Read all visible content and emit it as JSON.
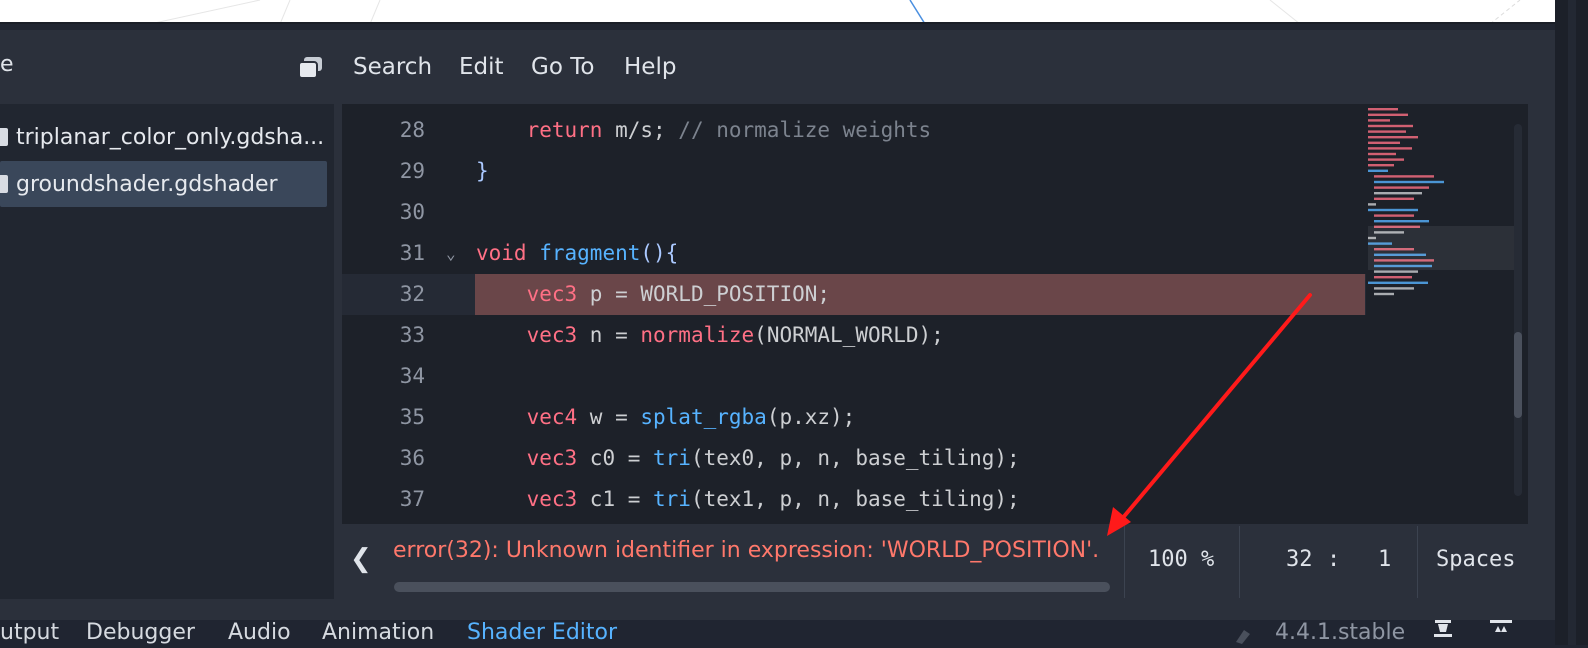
{
  "menu": {
    "left_partial": "e",
    "items": [
      "Search",
      "Edit",
      "Go To",
      "Help"
    ]
  },
  "files": [
    {
      "name": "triplanar_color_only.gdsha...",
      "selected": false
    },
    {
      "name": "groundshader.gdshader",
      "selected": true
    }
  ],
  "code_lines": [
    {
      "num": "28",
      "tokens": [
        [
          "    ",
          "id"
        ],
        [
          "return",
          "kw"
        ],
        [
          " m/s; ",
          "id"
        ],
        [
          "// normalize weights",
          "cm"
        ]
      ]
    },
    {
      "num": "29",
      "tokens": [
        [
          "}",
          "pn"
        ]
      ]
    },
    {
      "num": "30",
      "tokens": []
    },
    {
      "num": "31",
      "fold": true,
      "tokens": [
        [
          "void",
          "kw"
        ],
        [
          " ",
          "id"
        ],
        [
          "fragment",
          "fn"
        ],
        [
          "(){",
          "pn"
        ]
      ]
    },
    {
      "num": "32",
      "error": true,
      "tokens": [
        [
          "    ",
          "id"
        ],
        [
          "vec3",
          "kw"
        ],
        [
          " p = WORLD_POSITION;",
          "id"
        ]
      ]
    },
    {
      "num": "33",
      "tokens": [
        [
          "    ",
          "id"
        ],
        [
          "vec3",
          "kw"
        ],
        [
          " n = ",
          "id"
        ],
        [
          "normalize",
          "kw"
        ],
        [
          "(NORMAL_WORLD);",
          "id"
        ]
      ]
    },
    {
      "num": "34",
      "tokens": []
    },
    {
      "num": "35",
      "tokens": [
        [
          "    ",
          "id"
        ],
        [
          "vec4",
          "kw"
        ],
        [
          " w = ",
          "id"
        ],
        [
          "splat_rgba",
          "fn"
        ],
        [
          "(p.xz);",
          "id"
        ]
      ]
    },
    {
      "num": "36",
      "tokens": [
        [
          "    ",
          "id"
        ],
        [
          "vec3",
          "kw"
        ],
        [
          " c0 = ",
          "id"
        ],
        [
          "tri",
          "fn"
        ],
        [
          "(tex0, p, n, base_tiling);",
          "id"
        ]
      ]
    },
    {
      "num": "37",
      "tokens": [
        [
          "    ",
          "id"
        ],
        [
          "vec3",
          "kw"
        ],
        [
          " c1 = ",
          "id"
        ],
        [
          "tri",
          "fn"
        ],
        [
          "(tex1, p, n, base_tiling);",
          "id"
        ]
      ]
    }
  ],
  "status": {
    "back_icon": "chevron-left-icon",
    "error": "error(32): Unknown identifier in expression: 'WORLD_POSITION'.",
    "zoom": "100 %",
    "line": "32",
    "colon": ":",
    "column": "1",
    "indent": "Spaces"
  },
  "bottom_tabs": [
    {
      "label": "utput",
      "active": false
    },
    {
      "label": "Debugger",
      "active": false
    },
    {
      "label": "Audio",
      "active": false
    },
    {
      "label": "Animation",
      "active": false
    },
    {
      "label": "Shader Editor",
      "active": true
    }
  ],
  "version": "4.4.1.stable",
  "colors": {
    "accent": "#57b3ff",
    "error_text": "#ff786b",
    "error_line": "#6a4649",
    "annotation_arrow": "#ff1a1a"
  }
}
